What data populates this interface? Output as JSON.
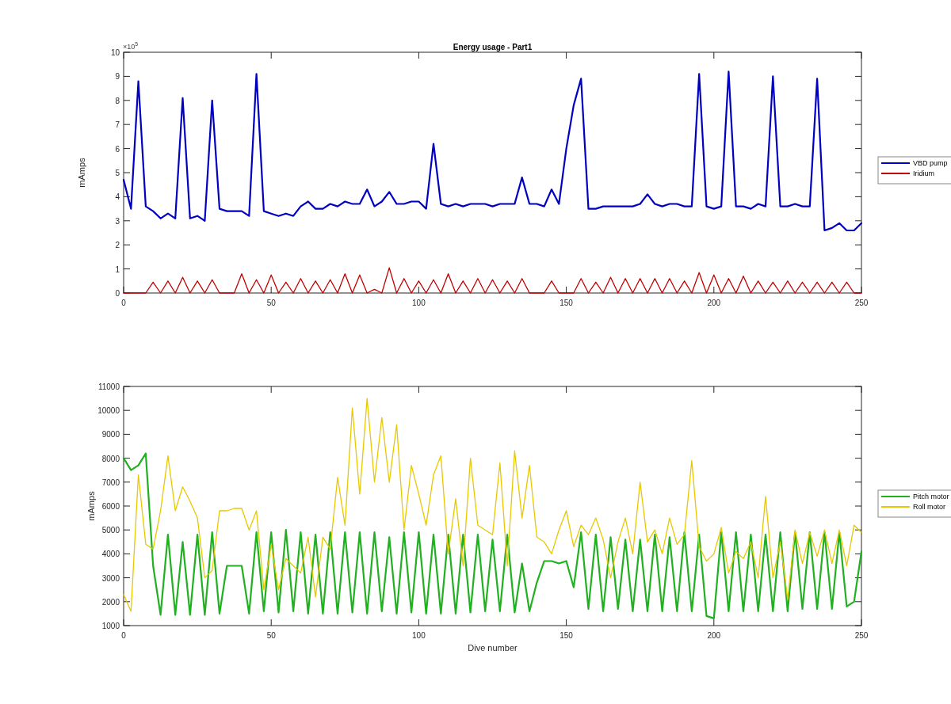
{
  "figure": {
    "panels": [
      {
        "chart_data": {
          "type": "line",
          "title": "Energy usage - Part1",
          "ylabel": "mAmps",
          "xlim": [
            0,
            250
          ],
          "ylim": [
            0,
            10
          ],
          "xticks": [
            0,
            50,
            100,
            150,
            200,
            250
          ],
          "yticks": [
            0,
            1,
            2,
            3,
            4,
            5,
            6,
            7,
            8,
            9,
            10
          ],
          "annotations": [
            {
              "text": "×10$^{5}$"
            }
          ],
          "legend": true,
          "x": [
            0,
            2.5,
            5,
            7.5,
            10,
            12.5,
            15,
            17.5,
            20,
            22.5,
            25,
            27.5,
            30,
            32.5,
            35,
            37.5,
            40,
            42.5,
            45,
            47.5,
            50,
            52.5,
            55,
            57.5,
            60,
            62.5,
            65,
            67.5,
            70,
            72.5,
            75,
            77.5,
            80,
            82.5,
            85,
            87.5,
            90,
            92.5,
            95,
            97.5,
            100,
            102.5,
            105,
            107.5,
            110,
            112.5,
            115,
            117.5,
            120,
            122.5,
            125,
            127.5,
            130,
            132.5,
            135,
            137.5,
            140,
            142.5,
            145,
            147.5,
            150,
            152.5,
            155,
            157.5,
            160,
            162.5,
            165,
            167.5,
            170,
            172.5,
            175,
            177.5,
            180,
            182.5,
            185,
            187.5,
            190,
            192.5,
            195,
            197.5,
            200,
            202.5,
            205,
            207.5,
            210,
            212.5,
            215,
            217.5,
            220,
            222.5,
            225,
            227.5,
            230,
            232.5,
            235,
            237.5,
            240,
            242.5,
            245,
            247.5,
            250
          ],
          "series": [
            {
              "name": "VBD pump",
              "color": "#0000c0",
              "values": [
                4.7,
                3.5,
                8.8,
                3.6,
                3.4,
                3.1,
                3.3,
                3.1,
                8.1,
                3.1,
                3.2,
                3.0,
                8.0,
                3.5,
                3.4,
                3.4,
                3.4,
                3.2,
                9.1,
                3.4,
                3.3,
                3.2,
                3.3,
                3.2,
                3.6,
                3.8,
                3.5,
                3.5,
                3.7,
                3.6,
                3.8,
                3.7,
                3.7,
                4.3,
                3.6,
                3.8,
                4.2,
                3.7,
                3.7,
                3.8,
                3.8,
                3.5,
                6.2,
                3.7,
                3.6,
                3.7,
                3.6,
                3.7,
                3.7,
                3.7,
                3.6,
                3.7,
                3.7,
                3.7,
                4.8,
                3.7,
                3.7,
                3.6,
                4.3,
                3.7,
                6.0,
                7.8,
                8.9,
                3.5,
                3.5,
                3.6,
                3.6,
                3.6,
                3.6,
                3.6,
                3.7,
                4.1,
                3.7,
                3.6,
                3.7,
                3.7,
                3.6,
                3.6,
                9.1,
                3.6,
                3.5,
                3.6,
                9.2,
                3.6,
                3.6,
                3.5,
                3.7,
                3.6,
                9.0,
                3.6,
                3.6,
                3.7,
                3.6,
                3.6,
                8.9,
                2.6,
                2.7,
                2.9,
                2.6,
                2.6,
                2.9
              ]
            },
            {
              "name": "Iridium",
              "color": "#c00000",
              "values": [
                0,
                0,
                0,
                0,
                0.45,
                0,
                0.5,
                0,
                0.65,
                0,
                0.5,
                0,
                0.55,
                0,
                0,
                0,
                0.8,
                0,
                0.55,
                0,
                0.75,
                0,
                0.45,
                0,
                0.6,
                0,
                0.5,
                0,
                0.55,
                0,
                0.8,
                0,
                0.75,
                0,
                0.15,
                0,
                1.05,
                0,
                0.6,
                0,
                0.5,
                0,
                0.55,
                0,
                0.8,
                0,
                0.5,
                0,
                0.6,
                0,
                0.55,
                0,
                0.5,
                0,
                0.6,
                0,
                0,
                0,
                0.5,
                0,
                0,
                0,
                0.6,
                0,
                0.45,
                0,
                0.65,
                0,
                0.6,
                0,
                0.6,
                0,
                0.6,
                0,
                0.6,
                0,
                0.5,
                0,
                0.85,
                0,
                0.75,
                0,
                0.6,
                0,
                0.7,
                0,
                0.5,
                0,
                0.45,
                0,
                0.5,
                0,
                0.45,
                0,
                0.45,
                0,
                0.45,
                0,
                0.45,
                0,
                0
              ]
            }
          ]
        }
      },
      {
        "chart_data": {
          "type": "line",
          "xlabel": "Dive number",
          "ylabel": "mAmps",
          "xlim": [
            0,
            250
          ],
          "ylim": [
            1000,
            11000
          ],
          "xticks": [
            0,
            50,
            100,
            150,
            200,
            250
          ],
          "yticks": [
            1000,
            2000,
            3000,
            4000,
            5000,
            6000,
            7000,
            8000,
            9000,
            10000,
            11000
          ],
          "legend": true,
          "x": [
            0,
            2.5,
            5,
            7.5,
            10,
            12.5,
            15,
            17.5,
            20,
            22.5,
            25,
            27.5,
            30,
            32.5,
            35,
            37.5,
            40,
            42.5,
            45,
            47.5,
            50,
            52.5,
            55,
            57.5,
            60,
            62.5,
            65,
            67.5,
            70,
            72.5,
            75,
            77.5,
            80,
            82.5,
            85,
            87.5,
            90,
            92.5,
            95,
            97.5,
            100,
            102.5,
            105,
            107.5,
            110,
            112.5,
            115,
            117.5,
            120,
            122.5,
            125,
            127.5,
            130,
            132.5,
            135,
            137.5,
            140,
            142.5,
            145,
            147.5,
            150,
            152.5,
            155,
            157.5,
            160,
            162.5,
            165,
            167.5,
            170,
            172.5,
            175,
            177.5,
            180,
            182.5,
            185,
            187.5,
            190,
            192.5,
            195,
            197.5,
            200,
            202.5,
            205,
            207.5,
            210,
            212.5,
            215,
            217.5,
            220,
            222.5,
            225,
            227.5,
            230,
            232.5,
            235,
            237.5,
            240,
            242.5,
            245,
            247.5,
            250
          ],
          "series": [
            {
              "name": "Pitch motor",
              "color": "#20b020",
              "values": [
                8000,
                7500,
                7700,
                8200,
                3500,
                1450,
                4800,
                1450,
                4500,
                1450,
                4800,
                1450,
                4900,
                1500,
                3500,
                3500,
                3500,
                1500,
                4900,
                1600,
                4900,
                1550,
                5000,
                1600,
                4900,
                1500,
                4800,
                1500,
                4900,
                1500,
                4900,
                1550,
                4900,
                1500,
                4900,
                1600,
                4700,
                1500,
                4900,
                1550,
                4900,
                1500,
                4800,
                1500,
                4800,
                1500,
                4800,
                1550,
                4800,
                1600,
                4600,
                1600,
                4800,
                1550,
                3600,
                1600,
                2800,
                3700,
                3700,
                3600,
                3700,
                2600,
                4900,
                1700,
                4800,
                1600,
                4700,
                1700,
                4600,
                1600,
                4600,
                1600,
                4800,
                1600,
                4700,
                1600,
                4900,
                1600,
                4800,
                1400,
                1300,
                4900,
                1600,
                4900,
                1600,
                4800,
                1600,
                4800,
                1600,
                4900,
                1600,
                4900,
                1700,
                4900,
                1700,
                4900,
                1700,
                4900,
                1800,
                2000,
                4100
              ]
            },
            {
              "name": "Roll motor",
              "color": "#e8c800",
              "values": [
                2300,
                1600,
                7300,
                4400,
                4200,
                5800,
                8100,
                5800,
                6800,
                6200,
                5500,
                3000,
                3300,
                5800,
                5800,
                5900,
                5900,
                5000,
                5800,
                2500,
                4400,
                2500,
                3800,
                3500,
                3200,
                4700,
                2200,
                4700,
                4200,
                7200,
                5200,
                10100,
                6500,
                10500,
                7000,
                9700,
                7000,
                9400,
                5000,
                7700,
                6500,
                5200,
                7300,
                8100,
                4000,
                6300,
                3500,
                8000,
                5200,
                5000,
                4800,
                7800,
                3500,
                8300,
                5500,
                7700,
                4700,
                4500,
                4000,
                5000,
                5800,
                4300,
                5200,
                4800,
                5500,
                4600,
                3000,
                4500,
                5500,
                4000,
                7000,
                4500,
                5000,
                4000,
                5500,
                4400,
                4800,
                7900,
                4300,
                3700,
                4000,
                5100,
                3200,
                4100,
                3800,
                4500,
                3000,
                6400,
                3000,
                4500,
                2100,
                5000,
                3600,
                4900,
                3900,
                5000,
                3600,
                5000,
                3500,
                5200,
                4900
              ]
            }
          ]
        }
      }
    ]
  }
}
